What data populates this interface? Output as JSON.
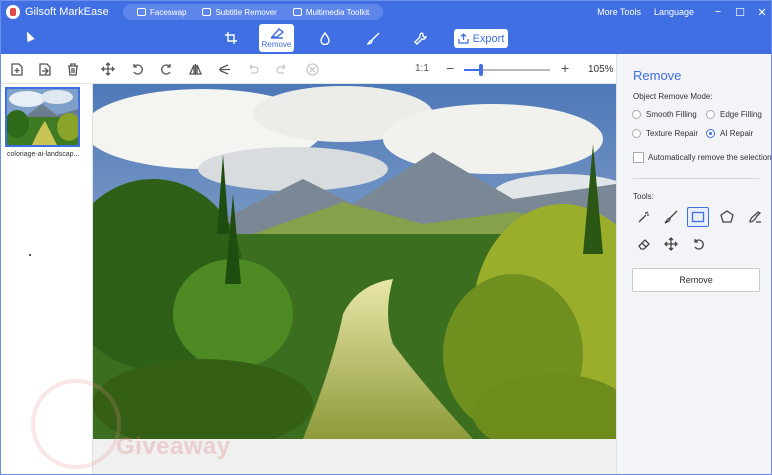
{
  "app": {
    "title": "Gilsoft MarkEase"
  },
  "title_links": [
    {
      "label": "Faceswap",
      "icon": "faceswap-icon"
    },
    {
      "label": "Subtitle Remover",
      "icon": "subtitle-icon"
    },
    {
      "label": "Multimedia Toolkit",
      "icon": "toolkit-icon"
    }
  ],
  "title_right": {
    "more_tools": "More Tools",
    "language": "Language"
  },
  "window_controls": {
    "minimize": "−",
    "maximize": "☐",
    "close": "✕"
  },
  "modes": {
    "crop_icon": "crop-icon",
    "remove_label": "Remove",
    "drop_icon": "watermark-drop-icon",
    "brush_icon": "brush-icon",
    "wrench_icon": "wrench-icon"
  },
  "export": {
    "label": "Export"
  },
  "toolbar": {
    "zoom_ratio": "1:1",
    "zoom_minus": "−",
    "zoom_plus": "+",
    "zoom_percent": "105%",
    "zoom_level": 0.2
  },
  "files": [
    {
      "name": "coloriage-ai-landscap..."
    }
  ],
  "right_panel": {
    "title": "Remove",
    "mode_label": "Object Remove Mode:",
    "modes": [
      {
        "label": "Smooth Filling",
        "selected": false
      },
      {
        "label": "Edge Filling",
        "selected": false
      },
      {
        "label": "Texture Repair",
        "selected": false
      },
      {
        "label": "AI Repair",
        "selected": true
      }
    ],
    "auto_remove_label": "Automatically remove the selection",
    "tools_label": "Tools:",
    "remove_button": "Remove"
  },
  "watermark": {
    "text": "Giveaway"
  },
  "colors": {
    "accent": "#3f6fe3",
    "panel_bg": "#f3f4f7"
  }
}
